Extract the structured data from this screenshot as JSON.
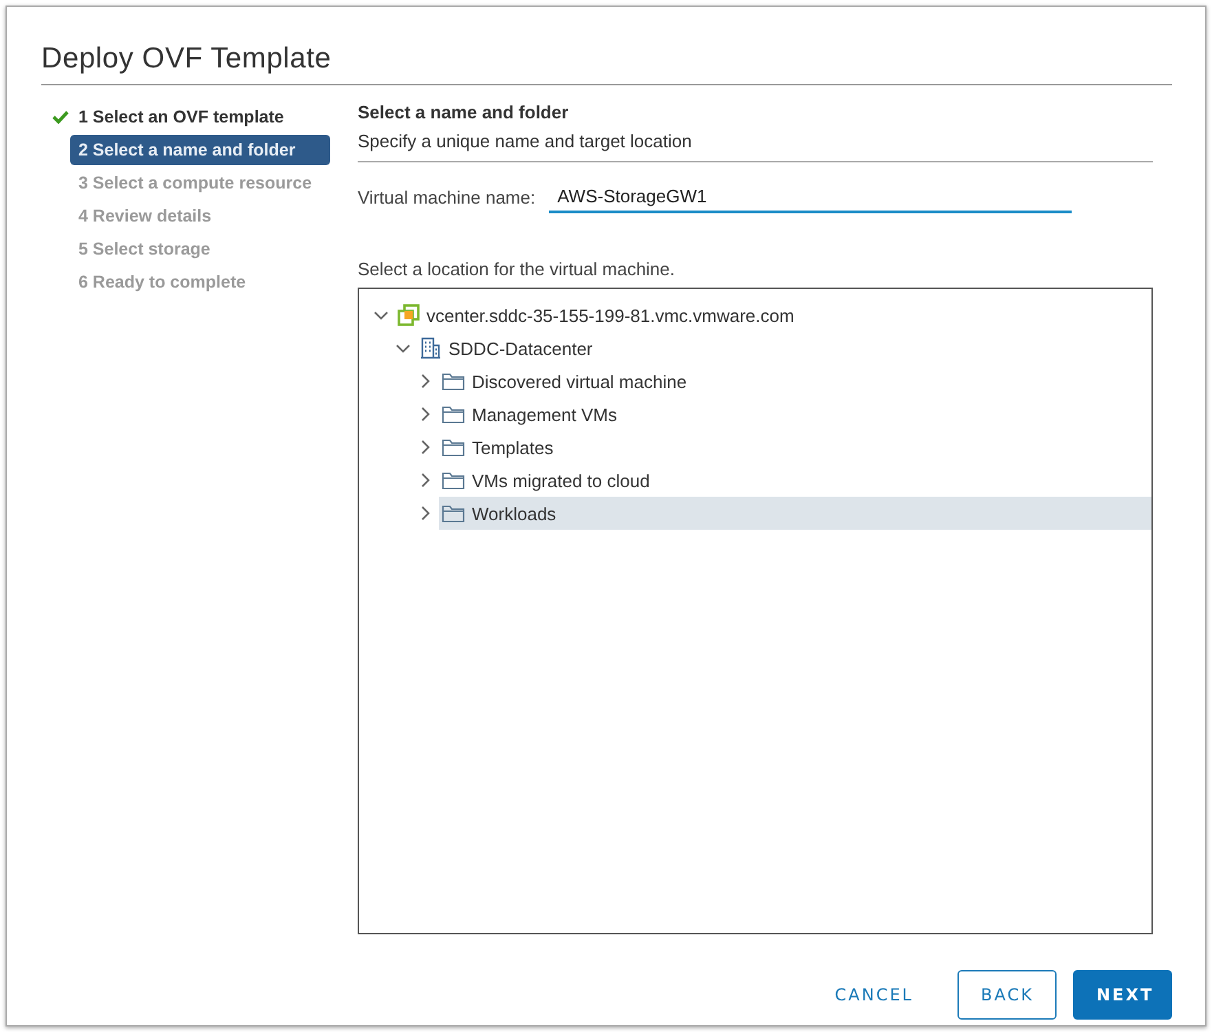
{
  "dialog": {
    "title": "Deploy OVF Template"
  },
  "steps": [
    {
      "label": "1 Select an OVF template",
      "completed": true,
      "selected": false
    },
    {
      "label": "2 Select a name and folder",
      "completed": false,
      "selected": true
    },
    {
      "label": "3 Select a compute resource",
      "completed": false,
      "selected": false
    },
    {
      "label": "4 Review details",
      "completed": false,
      "selected": false
    },
    {
      "label": "5 Select storage",
      "completed": false,
      "selected": false
    },
    {
      "label": "6 Ready to complete",
      "completed": false,
      "selected": false
    }
  ],
  "page": {
    "heading": "Select a name and folder",
    "subheading": "Specify a unique name and target location"
  },
  "vm_name_field": {
    "label": "Virtual machine name:",
    "value": "AWS-StorageGW1"
  },
  "location_label": "Select a location for the virtual machine.",
  "tree": [
    {
      "kind": "vcenter",
      "label": "vcenter.sddc-35-155-199-81.vmc.vmware.com",
      "expanded": true,
      "selected": false,
      "children": [
        {
          "kind": "datacenter",
          "label": "SDDC-Datacenter",
          "expanded": true,
          "selected": false,
          "children": [
            {
              "kind": "folder",
              "label": "Discovered virtual machine",
              "expanded": false,
              "selected": false
            },
            {
              "kind": "folder",
              "label": "Management VMs",
              "expanded": false,
              "selected": false
            },
            {
              "kind": "folder",
              "label": "Templates",
              "expanded": false,
              "selected": false
            },
            {
              "kind": "folder",
              "label": "VMs migrated to cloud",
              "expanded": false,
              "selected": false
            },
            {
              "kind": "folder",
              "label": "Workloads",
              "expanded": false,
              "selected": true
            }
          ]
        }
      ]
    }
  ],
  "buttons": [
    {
      "kind": "flat",
      "label": "CANCEL"
    },
    {
      "kind": "outline",
      "label": "BACK"
    },
    {
      "kind": "primary",
      "label": "NEXT"
    }
  ]
}
